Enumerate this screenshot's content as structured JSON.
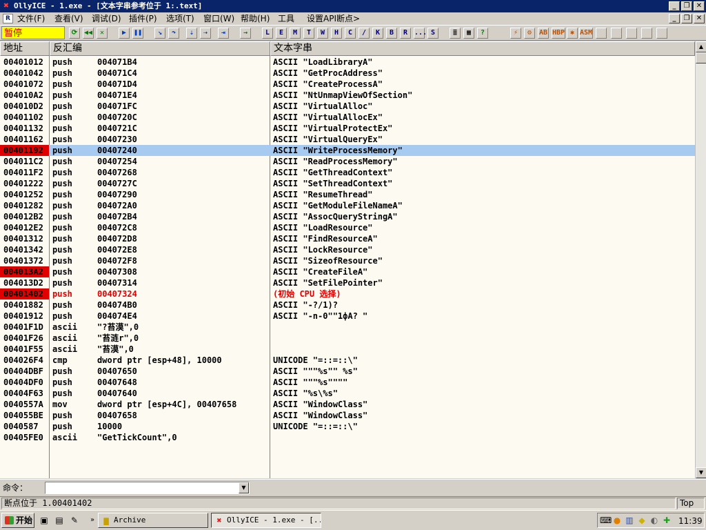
{
  "window": {
    "title": "OllyICE - 1.exe - [文本字串参考位于 1:.text]",
    "app_icon": "ollyice-x-icon"
  },
  "menu": {
    "doc_icon": "R",
    "items": [
      "文件(F)",
      "查看(V)",
      "调试(D)",
      "插件(P)",
      "选项(T)",
      "窗口(W)",
      "帮助(H)",
      "工具",
      "设置API断点>"
    ]
  },
  "toolbar": {
    "status": "暂停",
    "letters": [
      "L",
      "E",
      "M",
      "T",
      "W",
      "H",
      "C",
      "/",
      "K",
      "B",
      "R",
      "...",
      "S"
    ],
    "extra": [
      "HBP",
      "ASM"
    ]
  },
  "pane": {
    "headers": {
      "address": "地址",
      "disasm": "反汇编",
      "text": "文本字串"
    }
  },
  "rows": [
    {
      "addr": "00401012",
      "mn": "push",
      "op": "004071B4",
      "txt": "ASCII \"LoadLibraryA\""
    },
    {
      "addr": "00401042",
      "mn": "push",
      "op": "004071C4",
      "txt": "ASCII \"GetProcAddress\""
    },
    {
      "addr": "00401072",
      "mn": "push",
      "op": "004071D4",
      "txt": "ASCII \"CreateProcessA\""
    },
    {
      "addr": "004010A2",
      "mn": "push",
      "op": "004071E4",
      "txt": "ASCII \"NtUnmapViewOfSection\""
    },
    {
      "addr": "004010D2",
      "mn": "push",
      "op": "004071FC",
      "txt": "ASCII \"VirtualAlloc\""
    },
    {
      "addr": "00401102",
      "mn": "push",
      "op": "0040720C",
      "txt": "ASCII \"VirtualAllocEx\""
    },
    {
      "addr": "00401132",
      "mn": "push",
      "op": "0040721C",
      "txt": "ASCII \"VirtualProtectEx\""
    },
    {
      "addr": "00401162",
      "mn": "push",
      "op": "00407230",
      "txt": "ASCII \"VirtualQueryEx\""
    },
    {
      "addr": "00401192",
      "mn": "push",
      "op": "00407240",
      "txt": "ASCII \"WriteProcessMemory\""
    },
    {
      "addr": "004011C2",
      "mn": "push",
      "op": "00407254",
      "txt": "ASCII \"ReadProcessMemory\""
    },
    {
      "addr": "004011F2",
      "mn": "push",
      "op": "00407268",
      "txt": "ASCII \"GetThreadContext\""
    },
    {
      "addr": "00401222",
      "mn": "push",
      "op": "0040727C",
      "txt": "ASCII \"SetThreadContext\""
    },
    {
      "addr": "00401252",
      "mn": "push",
      "op": "00407290",
      "txt": "ASCII \"ResumeThread\""
    },
    {
      "addr": "00401282",
      "mn": "push",
      "op": "004072A0",
      "txt": "ASCII \"GetModuleFileNameA\""
    },
    {
      "addr": "004012B2",
      "mn": "push",
      "op": "004072B4",
      "txt": "ASCII \"AssocQueryStringA\""
    },
    {
      "addr": "004012E2",
      "mn": "push",
      "op": "004072C8",
      "txt": "ASCII \"LoadResource\""
    },
    {
      "addr": "00401312",
      "mn": "push",
      "op": "004072D8",
      "txt": "ASCII \"FindResourceA\""
    },
    {
      "addr": "00401342",
      "mn": "push",
      "op": "004072E8",
      "txt": "ASCII \"LockResource\""
    },
    {
      "addr": "00401372",
      "mn": "push",
      "op": "004072F8",
      "txt": "ASCII \"SizeofResource\""
    },
    {
      "addr": "004013A2",
      "mn": "push",
      "op": "00407308",
      "txt": "ASCII \"CreateFileA\""
    },
    {
      "addr": "004013D2",
      "mn": "push",
      "op": "00407314",
      "txt": "ASCII \"SetFilePointer\""
    },
    {
      "addr": "00401402",
      "mn": "push",
      "op": "00407324",
      "txt": "(初始 CPU 选择)"
    },
    {
      "addr": "00401882",
      "mn": "push",
      "op": "004074B0",
      "txt": "ASCII \"-?/1)?"
    },
    {
      "addr": "00401912",
      "mn": "push",
      "op": "004074E4",
      "txt": "ASCII \"-n-0\"\"1фА?  \""
    },
    {
      "addr": "00401F1D",
      "mn": "ascii",
      "op": "\"?苔漠\",0",
      "txt": ""
    },
    {
      "addr": "00401F26",
      "mn": "ascii",
      "op": "\"苔涟r\",0",
      "txt": ""
    },
    {
      "addr": "00401F55",
      "mn": "ascii",
      "op": "\"苔漠\",0",
      "txt": ""
    },
    {
      "addr": "004026F4",
      "mn": "cmp",
      "op": "dword ptr [esp+48], 10000",
      "txt": "UNICODE \"=::=::\\\""
    },
    {
      "addr": "00404DBF",
      "mn": "push",
      "op": "00407650",
      "txt": "ASCII \"\"\"%s\"\" %s\""
    },
    {
      "addr": "00404DF0",
      "mn": "push",
      "op": "00407648",
      "txt": "ASCII \"\"\"%s\"\"\"\""
    },
    {
      "addr": "00404F63",
      "mn": "push",
      "op": "00407640",
      "txt": "ASCII \"%s\\%s\""
    },
    {
      "addr": "0040557A",
      "mn": "mov",
      "op": "dword ptr [esp+4C], 00407658",
      "txt": "ASCII \"WindowClass\""
    },
    {
      "addr": "004055BE",
      "mn": "push",
      "op": "00407658",
      "txt": "ASCII \"WindowClass\""
    },
    {
      "addr": "0040587",
      "mn": "push",
      "op": "10000",
      "txt": "UNICODE \"=::=::\\\""
    },
    {
      "addr": "00405FE0",
      "mn": "ascii",
      "op": "\"GetTickCount\",0",
      "txt": ""
    }
  ],
  "row_flags": {
    "selected": [
      8
    ],
    "breakpoint": [
      8,
      19,
      21
    ],
    "red_text": [
      21
    ]
  },
  "command": {
    "label": "命令：",
    "value": ""
  },
  "status": {
    "message": "断点位于 1.00401402",
    "right": "Top"
  },
  "taskbar": {
    "start": "开始",
    "tasks": [
      "Archive",
      "OllyICE - 1.exe - [..."
    ],
    "clock": "11:39"
  },
  "colors": {
    "title_bg": "#0a246a",
    "selection": "#a6caf0",
    "breakpoint": "#e00000",
    "pane_bg": "#fdfaf2",
    "pause_bg": "#ffff00"
  }
}
